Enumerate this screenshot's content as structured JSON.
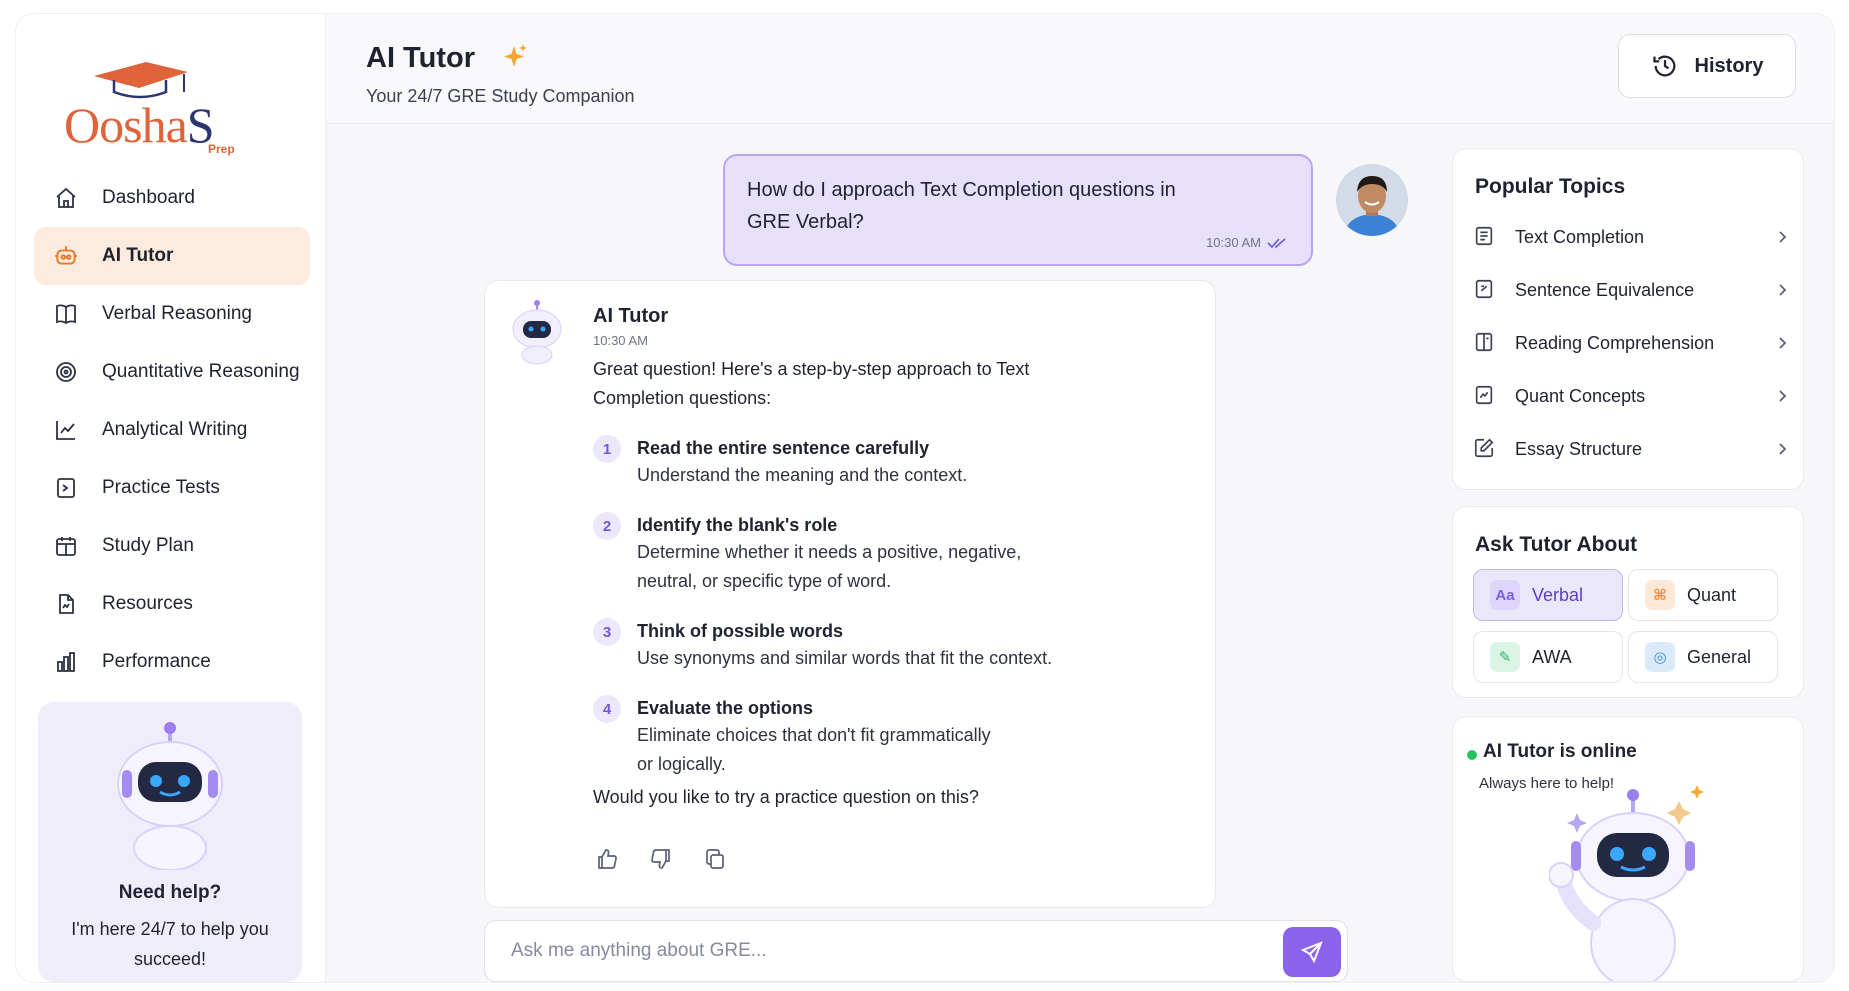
{
  "brand": {
    "logo_text_a": "Oosha",
    "logo_text_b": "S",
    "logo_sub": "Prep"
  },
  "nav": {
    "items": [
      {
        "label": "Dashboard",
        "icon": "home-icon"
      },
      {
        "label": "AI Tutor",
        "icon": "robot-icon",
        "active": true
      },
      {
        "label": "Verbal Reasoning",
        "icon": "book-icon"
      },
      {
        "label": "Quantitative Reasoning",
        "icon": "target-icon"
      },
      {
        "label": "Analytical Writing",
        "icon": "chart-line-icon"
      },
      {
        "label": "Practice Tests",
        "icon": "test-icon"
      },
      {
        "label": "Study Plan",
        "icon": "calendar-icon"
      },
      {
        "label": "Resources",
        "icon": "file-icon"
      },
      {
        "label": "Performance",
        "icon": "bar-chart-icon"
      }
    ]
  },
  "help": {
    "title": "Need help?",
    "body": "I'm here 24/7 to help you succeed!"
  },
  "header": {
    "title": "AI Tutor",
    "subtitle": "Your 24/7 GRE Study Companion",
    "history_label": "History"
  },
  "user_message": {
    "text": "How do I approach Text Completion questions in GRE Verbal?",
    "time": "10:30 AM"
  },
  "bot_message": {
    "name": "AI Tutor",
    "time": "10:30 AM",
    "intro": "Great question! Here's a step-by-step approach to Text Completion questions:",
    "steps": [
      {
        "num": "1",
        "title": "Read the entire sentence carefully",
        "body": "Understand the meaning and the context."
      },
      {
        "num": "2",
        "title": "Identify the blank's role",
        "body": "Determine whether it needs a positive, negative,\nneutral, or specific type of word."
      },
      {
        "num": "3",
        "title": "Think of possible words",
        "body": "Use synonyms and similar words that fit the context."
      },
      {
        "num": "4",
        "title": "Evaluate the options",
        "body": "Eliminate choices that don't fit grammatically\nor logically."
      }
    ],
    "outro": "Would you like to try a practice question on this?"
  },
  "input": {
    "placeholder": "Ask me anything about GRE..."
  },
  "popular_topics": {
    "title": "Popular Topics",
    "items": [
      {
        "label": "Text Completion",
        "icon": "document-icon"
      },
      {
        "label": "Sentence Equivalence",
        "icon": "equivalence-icon"
      },
      {
        "label": "Reading Comprehension",
        "icon": "reading-icon"
      },
      {
        "label": "Quant Concepts",
        "icon": "chart-icon"
      },
      {
        "label": "Essay Structure",
        "icon": "edit-icon"
      }
    ]
  },
  "ask_about": {
    "title": "Ask Tutor About",
    "chips": [
      {
        "label": "Verbal",
        "glyph": "Aa",
        "color": "#7b5fe0",
        "bg": "#ddd5fb",
        "active": true
      },
      {
        "label": "Quant",
        "glyph": "⌘",
        "color": "#f08a3c",
        "bg": "#fde7d6"
      },
      {
        "label": "AWA",
        "glyph": "✎",
        "color": "#2fb36a",
        "bg": "#daf5e5"
      },
      {
        "label": "General",
        "glyph": "◎",
        "color": "#3b8de0",
        "bg": "#dbeaf9"
      }
    ]
  },
  "status": {
    "title": "AI Tutor is online",
    "subtitle": "Always here to help!"
  }
}
